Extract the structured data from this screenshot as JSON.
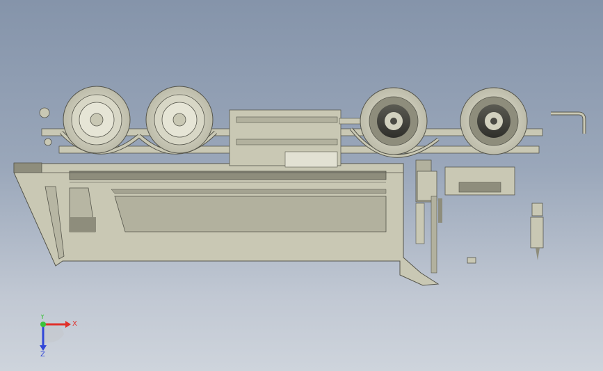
{
  "viewport": {
    "background_top": "#8594aa",
    "background_bottom": "#ced4dc"
  },
  "model": {
    "body_color": "#c9c8b4",
    "body_dark": "#8e8d7c",
    "rubber_color": "#d2d1bf",
    "hub_dark": "#4a4a44"
  },
  "triad": {
    "x_label": "X",
    "y_label": "Y",
    "z_label": "Z",
    "x_color": "#e0302a",
    "y_color": "#3ac23a",
    "z_color": "#3046d8"
  }
}
